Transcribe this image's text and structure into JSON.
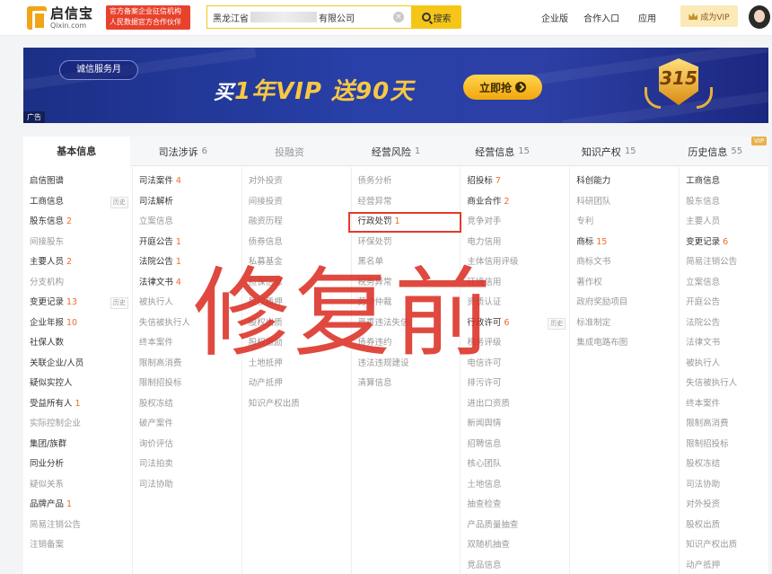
{
  "header": {
    "logo_cn": "启信宝",
    "logo_en": "Qixin.com",
    "official_badge_line1": "官方备案企业征信机构",
    "official_badge_line2": "人民数据官方合作伙伴",
    "search_value_prefix": "黑龙江省",
    "search_value_suffix": "有限公司",
    "search_button": "搜索",
    "nav": [
      "企业版",
      "合作入口",
      "应用"
    ],
    "vip_button": "成为VIP"
  },
  "banner": {
    "tag": "诚信服务月",
    "headline_a": "买",
    "headline_b": "1年VIP 送",
    "headline_c": "90天",
    "cta": "立即抢",
    "badge_number": "315",
    "ad_label": "广告"
  },
  "tabs": [
    {
      "label": "基本信息",
      "count": ""
    },
    {
      "label": "司法涉诉",
      "count": "6"
    },
    {
      "label": "投融资",
      "count": ""
    },
    {
      "label": "经营风险",
      "count": "1"
    },
    {
      "label": "经营信息",
      "count": "15"
    },
    {
      "label": "知识产权",
      "count": "15"
    },
    {
      "label": "历史信息",
      "count": "55"
    }
  ],
  "vip_tag": "VIP",
  "history_tag": "历史",
  "columns": [
    [
      {
        "label": "启信图谱",
        "count": ""
      },
      {
        "label": "工商信息",
        "count": "",
        "hist": true
      },
      {
        "label": "股东信息",
        "count": "2"
      },
      {
        "label": "间接股东",
        "count": "",
        "dim": true
      },
      {
        "label": "主要人员",
        "count": "2"
      },
      {
        "label": "分支机构",
        "count": "",
        "dim": true
      },
      {
        "label": "变更记录",
        "count": "13",
        "hist": true
      },
      {
        "label": "企业年报",
        "count": "10"
      },
      {
        "label": "社保人数",
        "count": ""
      },
      {
        "label": "关联企业/人员",
        "count": ""
      },
      {
        "label": "疑似实控人",
        "count": ""
      },
      {
        "label": "受益所有人",
        "count": "1"
      },
      {
        "label": "实际控制企业",
        "count": "",
        "dim": true
      },
      {
        "label": "集团/族群",
        "count": ""
      },
      {
        "label": "同业分析",
        "count": ""
      },
      {
        "label": "疑似关系",
        "count": "",
        "dim": true
      },
      {
        "label": "品牌产品",
        "count": "1"
      },
      {
        "label": "简易注销公告",
        "count": "",
        "dim": true
      },
      {
        "label": "注销备案",
        "count": "",
        "dim": true
      }
    ],
    [
      {
        "label": "司法案件",
        "count": "4"
      },
      {
        "label": "司法解析",
        "count": ""
      },
      {
        "label": "立案信息",
        "count": "",
        "dim": true
      },
      {
        "label": "开庭公告",
        "count": "1"
      },
      {
        "label": "法院公告",
        "count": "1"
      },
      {
        "label": "法律文书",
        "count": "4"
      },
      {
        "label": "被执行人",
        "count": "",
        "dim": true
      },
      {
        "label": "失信被执行人",
        "count": "",
        "dim": true
      },
      {
        "label": "终本案件",
        "count": "",
        "dim": true
      },
      {
        "label": "限制高消费",
        "count": "",
        "dim": true
      },
      {
        "label": "限制招投标",
        "count": "",
        "dim": true
      },
      {
        "label": "股权冻结",
        "count": "",
        "dim": true
      },
      {
        "label": "破产案件",
        "count": "",
        "dim": true
      },
      {
        "label": "询价评估",
        "count": "",
        "dim": true
      },
      {
        "label": "司法拍卖",
        "count": "",
        "dim": true
      },
      {
        "label": "司法协助",
        "count": "",
        "dim": true
      }
    ],
    [
      {
        "label": "对外投资",
        "count": "",
        "dim": true
      },
      {
        "label": "间接投资",
        "count": "",
        "dim": true
      },
      {
        "label": "融资历程",
        "count": "",
        "dim": true
      },
      {
        "label": "债券信息",
        "count": "",
        "dim": true
      },
      {
        "label": "私募基金",
        "count": "",
        "dim": true
      },
      {
        "label": "担保信息",
        "count": "",
        "dim": true
      },
      {
        "label": "股权质押",
        "count": "",
        "dim": true
      },
      {
        "label": "股权出质",
        "count": "",
        "dim": true
      },
      {
        "label": "股权激励",
        "count": "",
        "dim": true
      },
      {
        "label": "土地抵押",
        "count": "",
        "dim": true
      },
      {
        "label": "动产抵押",
        "count": "",
        "dim": true
      },
      {
        "label": "知识产权出质",
        "count": "",
        "dim": true
      }
    ],
    [
      {
        "label": "债务分析",
        "count": "",
        "dim": true
      },
      {
        "label": "经营异常",
        "count": "",
        "dim": true
      },
      {
        "label": "行政处罚",
        "count": "1",
        "boxed": true
      },
      {
        "label": "环保处罚",
        "count": "",
        "dim": true
      },
      {
        "label": "黑名单",
        "count": "",
        "dim": true
      },
      {
        "label": "税务异常",
        "count": "",
        "dim": true
      },
      {
        "label": "劳动仲裁",
        "count": "",
        "dim": true
      },
      {
        "label": "严重违法失信",
        "count": "",
        "dim": true
      },
      {
        "label": "债券违约",
        "count": "",
        "dim": true
      },
      {
        "label": "违法违规建设",
        "count": "",
        "dim": true
      },
      {
        "label": "清算信息",
        "count": "",
        "dim": true
      }
    ],
    [
      {
        "label": "招投标",
        "count": "7"
      },
      {
        "label": "商业合作",
        "count": "2"
      },
      {
        "label": "竞争对手",
        "count": "",
        "dim": true
      },
      {
        "label": "电力信用",
        "count": "",
        "dim": true
      },
      {
        "label": "主体信用评级",
        "count": "",
        "dim": true
      },
      {
        "label": "环境信用",
        "count": "",
        "dim": true
      },
      {
        "label": "资质认证",
        "count": "",
        "dim": true
      },
      {
        "label": "行政许可",
        "count": "6",
        "hist": true
      },
      {
        "label": "税务评级",
        "count": "",
        "dim": true
      },
      {
        "label": "电信许可",
        "count": "",
        "dim": true
      },
      {
        "label": "排污许可",
        "count": "",
        "dim": true
      },
      {
        "label": "进出口资质",
        "count": "",
        "dim": true
      },
      {
        "label": "新闻舆情",
        "count": "",
        "dim": true
      },
      {
        "label": "招聘信息",
        "count": "",
        "dim": true
      },
      {
        "label": "核心团队",
        "count": "",
        "dim": true
      },
      {
        "label": "土地信息",
        "count": "",
        "dim": true
      },
      {
        "label": "抽查检查",
        "count": "",
        "dim": true
      },
      {
        "label": "产品质量抽查",
        "count": "",
        "dim": true
      },
      {
        "label": "双随机抽查",
        "count": "",
        "dim": true
      },
      {
        "label": "竞品信息",
        "count": "",
        "dim": true
      }
    ],
    [
      {
        "label": "科创能力",
        "count": ""
      },
      {
        "label": "科研团队",
        "count": "",
        "dim": true
      },
      {
        "label": "专利",
        "count": "",
        "dim": true
      },
      {
        "label": "商标",
        "count": "15"
      },
      {
        "label": "商标文书",
        "count": "",
        "dim": true
      },
      {
        "label": "著作权",
        "count": "",
        "dim": true
      },
      {
        "label": "政府奖励项目",
        "count": "",
        "dim": true
      },
      {
        "label": "标准制定",
        "count": "",
        "dim": true
      },
      {
        "label": "集成电路布图",
        "count": "",
        "dim": true
      }
    ],
    [
      {
        "label": "工商信息",
        "count": ""
      },
      {
        "label": "股东信息",
        "count": "",
        "dim": true
      },
      {
        "label": "主要人员",
        "count": "",
        "dim": true
      },
      {
        "label": "变更记录",
        "count": "6"
      },
      {
        "label": "简易注销公告",
        "count": "",
        "dim": true
      },
      {
        "label": "立案信息",
        "count": "",
        "dim": true
      },
      {
        "label": "开庭公告",
        "count": "",
        "dim": true
      },
      {
        "label": "法院公告",
        "count": "",
        "dim": true
      },
      {
        "label": "法律文书",
        "count": "",
        "dim": true
      },
      {
        "label": "被执行人",
        "count": "",
        "dim": true
      },
      {
        "label": "失信被执行人",
        "count": "",
        "dim": true
      },
      {
        "label": "终本案件",
        "count": "",
        "dim": true
      },
      {
        "label": "限制高消费",
        "count": "",
        "dim": true
      },
      {
        "label": "限制招投标",
        "count": "",
        "dim": true
      },
      {
        "label": "股权冻结",
        "count": "",
        "dim": true
      },
      {
        "label": "司法协助",
        "count": "",
        "dim": true
      },
      {
        "label": "对外投资",
        "count": "",
        "dim": true
      },
      {
        "label": "股权出质",
        "count": "",
        "dim": true
      },
      {
        "label": "知识产权出质",
        "count": "",
        "dim": true
      },
      {
        "label": "动产抵押",
        "count": "",
        "dim": true
      }
    ]
  ],
  "watermark": "修复前"
}
